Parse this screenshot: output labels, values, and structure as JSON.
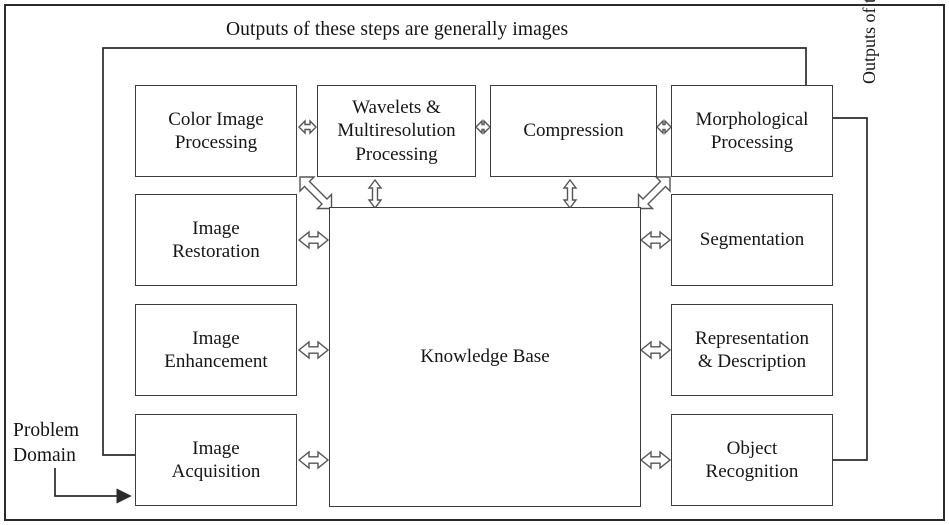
{
  "diagram": {
    "title_top": "Outputs of these steps are generally images",
    "title_right": "Outputs of these steps are generally image attributes",
    "source_label": "Problem\nDomain",
    "center": {
      "label": "Knowledge Base"
    },
    "top_row": [
      {
        "id": "color-image-processing",
        "label": "Color Image\nProcessing"
      },
      {
        "id": "wavelets-multiresolution-processing",
        "label": "Wavelets &\nMultiresolution\nProcessing"
      },
      {
        "id": "compression",
        "label": "Compression"
      },
      {
        "id": "morphological-processing",
        "label": "Morphological\nProcessing"
      }
    ],
    "left_column": [
      {
        "id": "image-restoration",
        "label": "Image\nRestoration"
      },
      {
        "id": "image-enhancement",
        "label": "Image\nEnhancement"
      },
      {
        "id": "image-acquisition",
        "label": "Image\nAcquisition"
      }
    ],
    "right_column": [
      {
        "id": "segmentation",
        "label": "Segmentation"
      },
      {
        "id": "representation-description",
        "label": "Representation\n& Description"
      },
      {
        "id": "object-recognition",
        "label": "Object\nRecognition"
      }
    ],
    "colors": {
      "stroke": "#3d3d3d",
      "frame": "#2b2b2b",
      "text": "#151515",
      "background": "#ffffff"
    }
  }
}
